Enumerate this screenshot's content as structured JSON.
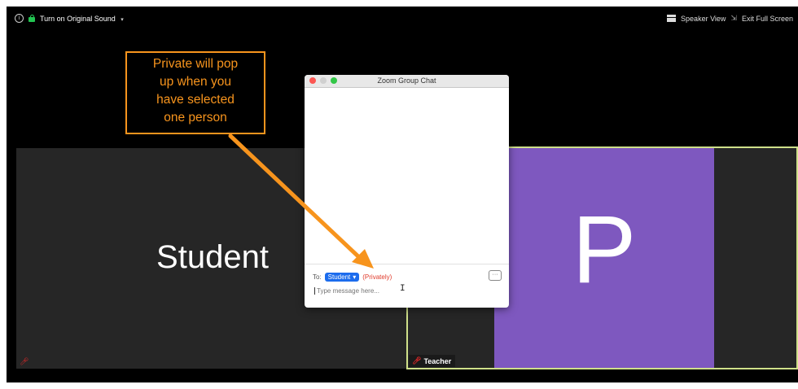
{
  "topbar": {
    "info_icon": "i",
    "original_sound_label": "Turn on Original Sound",
    "caret": "▾",
    "speaker_view_label": "Speaker View",
    "exit_fullscreen_label": "Exit Full Screen"
  },
  "tiles": {
    "student_name": "Student",
    "teacher_initial": "P",
    "teacher_name": "Teacher"
  },
  "chat": {
    "title": "Zoom Group Chat",
    "to_label": "To:",
    "recipient": "Student",
    "recipient_caret": "▾",
    "privately_label": "(Privately)",
    "more_label": "···",
    "input_placeholder": "Type message here..."
  },
  "callout": {
    "line1": "Private will pop",
    "line2": "up when you",
    "line3": "have selected",
    "line4": "one person"
  },
  "colors": {
    "callout": "#f7941d",
    "avatar": "#7e58bf",
    "active_speaker_border": "#cfe08a",
    "recipient_button": "#1c6ced",
    "privately": "#e03a2a"
  },
  "icons": [
    "info-icon",
    "lock-icon",
    "grid-icon",
    "exit-fullscreen-icon",
    "mic-muted-icon",
    "more-options-icon"
  ]
}
